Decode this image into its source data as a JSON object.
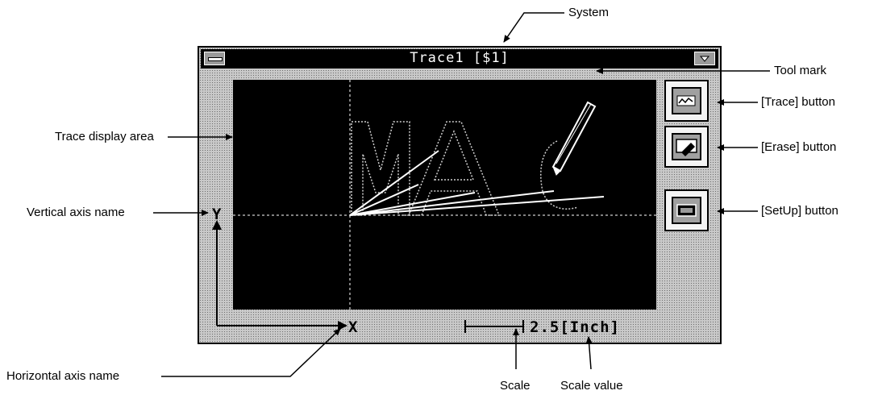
{
  "window": {
    "title": "Trace1 [$1]",
    "horizontal_axis_name": "X",
    "vertical_axis_name": "Y",
    "scale_value": "2.5[Inch]"
  },
  "callouts": {
    "system": "System",
    "tool_mark": "Tool mark",
    "trace_button": "[Trace] button",
    "erase_button": "[Erase] button",
    "setup_button": "[SetUp] button",
    "trace_display_area": "Trace display area",
    "vertical_axis_name": "Vertical axis name",
    "horizontal_axis_name": "Horizontal axis name",
    "scale": "Scale",
    "scale_value": "Scale value"
  },
  "colors": {
    "frame": "#c9c9c9",
    "display_background": "#000000",
    "trace": "#ffffff"
  }
}
